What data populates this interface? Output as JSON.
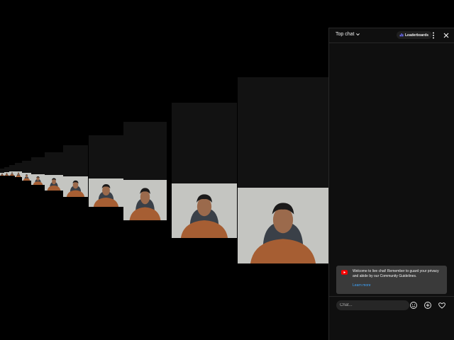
{
  "chat": {
    "mode_label": "Top chat",
    "leaderboard_label": "Leaderboards",
    "welcome_message": "Welcome to live chat! Remember to guard your privacy and abide by our Community Guidelines.",
    "learn_more_label": "Learn more",
    "input_placeholder": "Chat...",
    "icons": {
      "mode": "chevron-down-icon",
      "leaderboard": "leaderboard-icon",
      "more": "more-vert-icon",
      "close": "close-icon",
      "welcome": "youtube-logo-icon",
      "emoji": "emoji-icon",
      "add": "add-circle-icon",
      "support": "heart-icon"
    }
  },
  "theme": {
    "panel_bg": "#0f0f0f",
    "card_bg": "#3a3a3a",
    "link": "#3ea6ff",
    "brand_red": "#ff0000",
    "text": "#f1f1f1"
  }
}
